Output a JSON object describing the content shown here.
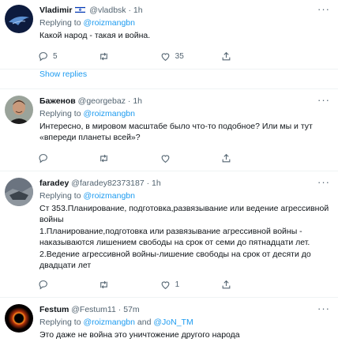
{
  "tweets": [
    {
      "name": "Vladimir",
      "handle": "@vladbsk",
      "dot": "·",
      "time": "1h",
      "replying_label": "Replying to",
      "mention": "@roizmangbn",
      "text": "Какой народ - такая и война.",
      "replies": "5",
      "retweets": "",
      "likes": "35"
    },
    {
      "name": "Баженов",
      "handle": "@georgebaz",
      "dot": "·",
      "time": "1h",
      "replying_label": "Replying to",
      "mention": "@roizmangbn",
      "text": "Интересно, в мировом масштабе было что-то подобное? Или мы и тут «впереди планеты всей»?",
      "replies": "",
      "retweets": "",
      "likes": ""
    },
    {
      "name": "faradey",
      "handle": "@faradey82373187",
      "dot": "·",
      "time": "1h",
      "replying_label": "Replying to",
      "mention": "@roizmangbn",
      "text1": "Ст 353.Планирование, подготовка,развязывание или ведение агрессивной войны",
      "text2": "1.Планирование,подготовка или развязывание агрессивной войны - наказываются лишением свободы на срок от семи до пятнадцати лет.",
      "text3": "2.Ведение агрессивной войны-лишение свободы на срок от десяти до двадцати лет",
      "replies": "",
      "retweets": "",
      "likes": "1"
    },
    {
      "name": "Festum",
      "handle": "@Festum11",
      "dot": "·",
      "time": "57m",
      "replying_label": "Replying to",
      "mention": "@roizmangbn",
      "and": "and",
      "mention2": "@JoN_TM",
      "text": "Это даже не война это уничтожение другого народа"
    }
  ],
  "show_replies": "Show replies",
  "more_glyph": "···",
  "colors": {
    "accent": "#1d9bf0",
    "secondary": "#536471",
    "text": "#0f1419"
  }
}
